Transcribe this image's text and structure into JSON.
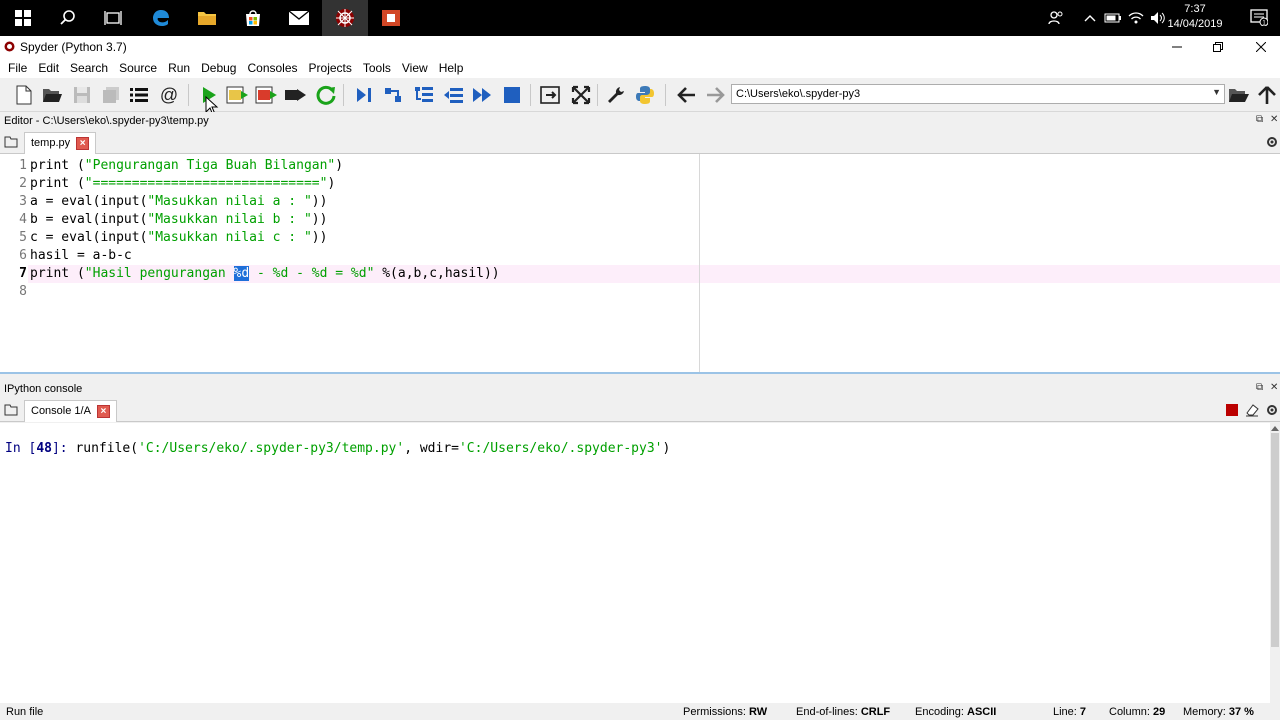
{
  "taskbar": {
    "icons": [
      "windows-start-icon",
      "search-icon",
      "task-view-icon",
      "edge-browser-icon",
      "file-explorer-icon",
      "store-icon",
      "mail-icon",
      "spyder-icon",
      "powerpoint-icon"
    ],
    "time": "7:37",
    "date": "14/04/2019"
  },
  "window": {
    "title": "Spyder (Python 3.7)"
  },
  "menu": [
    "File",
    "Edit",
    "Search",
    "Source",
    "Run",
    "Debug",
    "Consoles",
    "Projects",
    "Tools",
    "View",
    "Help"
  ],
  "toolbar": {
    "path": "C:\\Users\\eko\\.spyder-py3"
  },
  "editor": {
    "pane_title": "Editor - C:\\Users\\eko\\.spyder-py3\\temp.py",
    "tab": "temp.py",
    "line_numbers": [
      "1",
      "2",
      "3",
      "4",
      "5",
      "6",
      "7",
      "8"
    ],
    "lines": {
      "l1": {
        "a": "print (",
        "s": "\"Pengurangan Tiga Buah Bilangan\"",
        "b": ")"
      },
      "l2": {
        "a": "print (",
        "s": "\"=============================\"",
        "b": ")"
      },
      "l3": {
        "a": "a = eval(input(",
        "s": "\"Masukkan nilai a : \"",
        "b": "))"
      },
      "l4": {
        "a": "b = eval(input(",
        "s": "\"Masukkan nilai b : \"",
        "b": "))"
      },
      "l5": {
        "a": "c = eval(input(",
        "s": "\"Masukkan nilai c : \"",
        "b": "))"
      },
      "l6": {
        "a": "hasil = a-b-c"
      },
      "l7": {
        "a": "print (",
        "s1": "\"Hasil pengurangan ",
        "sel": "%d",
        "s2": " - %d - %d = %d\"",
        "b": " %(a,b,c,hasil))"
      }
    }
  },
  "console": {
    "pane_title": "IPython console",
    "tab": "Console 1/A",
    "prompt": "In [",
    "prompt_num": "48",
    "prompt_end": "]: ",
    "cmd_a": "runfile(",
    "cmd_s1": "'C:/Users/eko/.spyder-py3/temp.py'",
    "cmd_b": ", wdir=",
    "cmd_s2": "'C:/Users/eko/.spyder-py3'",
    "cmd_c": ")"
  },
  "status": {
    "left": "Run file",
    "permissions_label": "Permissions:",
    "permissions": "RW",
    "eol_label": "End-of-lines:",
    "eol": "CRLF",
    "encoding_label": "Encoding:",
    "encoding": "ASCII",
    "line_label": "Line:",
    "line": "7",
    "column_label": "Column:",
    "column": "29",
    "memory_label": "Memory:",
    "memory": "37 %"
  },
  "colors": {
    "string": "#00a000",
    "selection": "#1e6fd9",
    "current_line": "#fdeefa",
    "run_green": "#1aa31a"
  }
}
